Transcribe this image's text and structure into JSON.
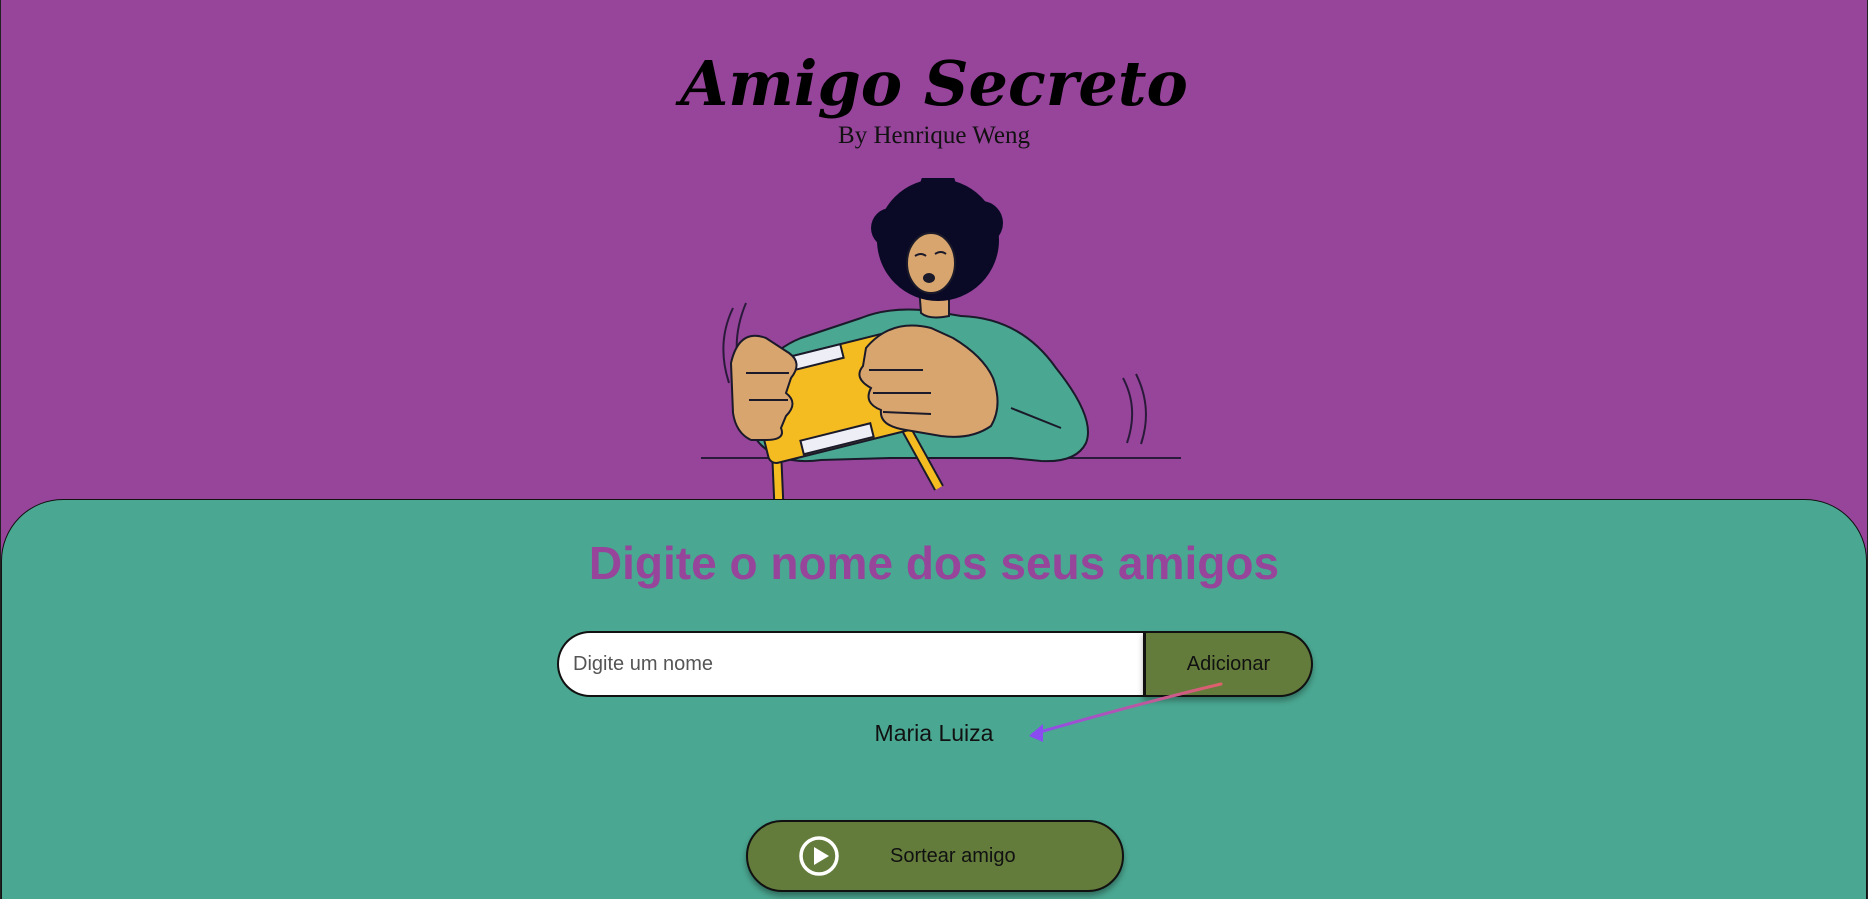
{
  "header": {
    "title": "Amigo Secreto",
    "byline": "By Henrique Weng"
  },
  "main": {
    "section_title": "Digite o nome dos seus amigos",
    "name_input": {
      "placeholder": "Digite um nome",
      "value": ""
    },
    "add_button_label": "Adicionar",
    "friends": [
      "Maria Luiza"
    ],
    "draw_button_label": "Sortear amigo"
  },
  "icons": {
    "draw_button_icon": "play-circle-icon",
    "illustration": "person-playing-handheld-console-illustration"
  },
  "colors": {
    "background_purple": "#97449b",
    "panel_green": "#4aa791",
    "button_olive": "#637c3b",
    "title_purple": "#97449b"
  }
}
